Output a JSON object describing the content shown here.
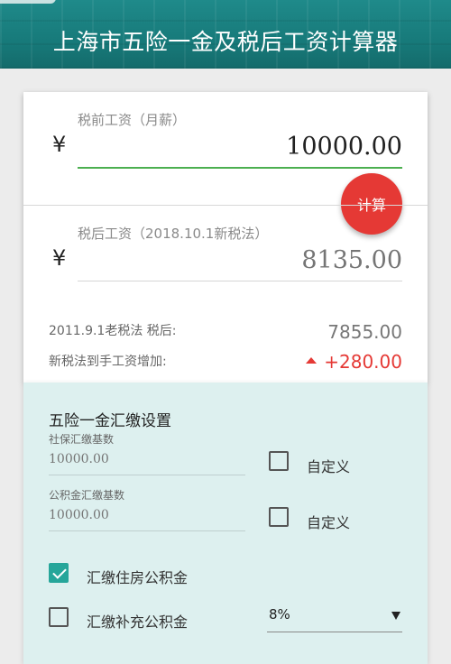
{
  "header": {
    "title": "上海市五险一金及税后工资计算器"
  },
  "pre_tax": {
    "label": "税前工资（月薪）",
    "currency": "¥",
    "value": "10000.00"
  },
  "calculate_button": {
    "label": "计算"
  },
  "post_tax": {
    "label": "税后工资（2018.10.1新税法）",
    "currency": "¥",
    "placeholder": "8135.00"
  },
  "old_law": {
    "label": "2011.9.1老税法 税后:",
    "value": "7855.00"
  },
  "increase": {
    "label": "新税法到手工资增加:",
    "value": "+280.00"
  },
  "settings": {
    "title": "五险一金汇缴设置",
    "social_base": {
      "label": "社保汇缴基数",
      "placeholder": "10000.00",
      "custom_label": "自定义",
      "custom_checked": false
    },
    "fund_base": {
      "label": "公积金汇缴基数",
      "placeholder": "10000.00",
      "custom_label": "自定义",
      "custom_checked": false
    },
    "housing_fund": {
      "label": "汇缴住房公积金",
      "checked": true
    },
    "supplementary_fund": {
      "label": "汇缴补充公积金",
      "checked": false,
      "rate": "8%"
    }
  },
  "colors": {
    "header": "#1b8383",
    "accent_red": "#e53935",
    "check_teal": "#26a69a",
    "input_green": "#4caf50"
  }
}
